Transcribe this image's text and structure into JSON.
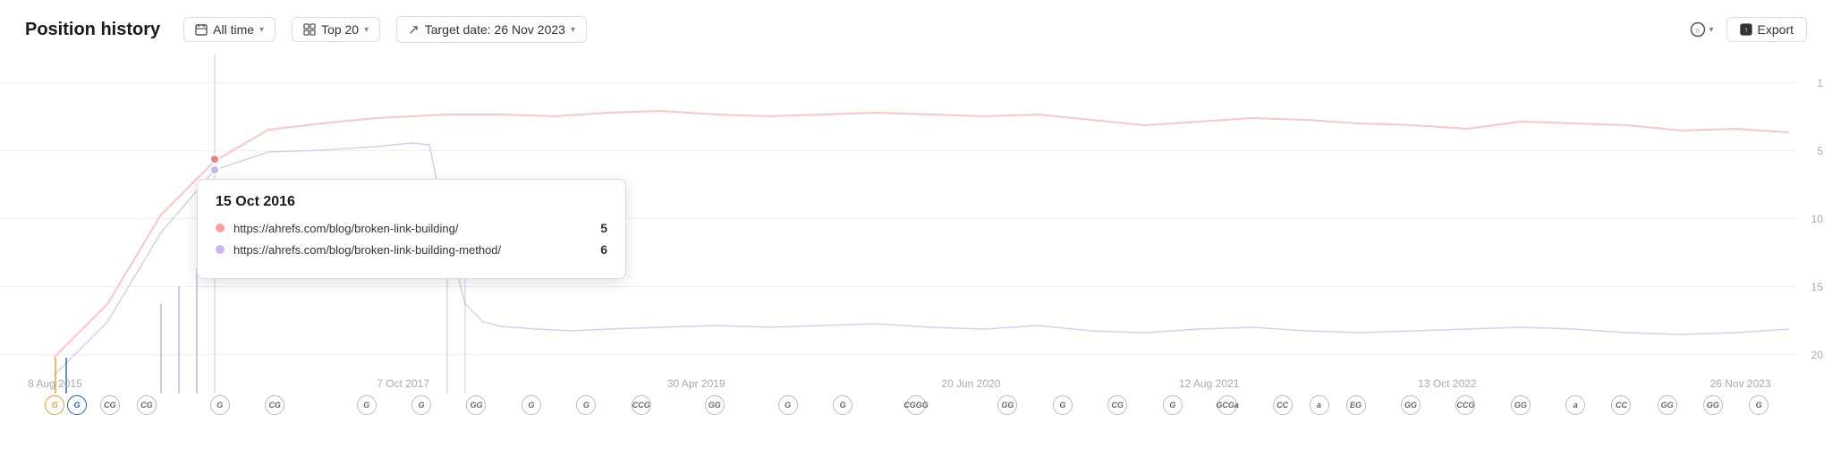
{
  "header": {
    "title": "Position history",
    "alltime_label": "All time",
    "top_label": "Top 20",
    "target_label": "Target date: 26 Nov 2023",
    "export_label": "Export"
  },
  "tooltip": {
    "date": "15 Oct 2016",
    "rows": [
      {
        "url": "https://ahrefs.com/blog/broken-link-building/",
        "value": "5",
        "color": "#f9a0a0"
      },
      {
        "url": "https://ahrefs.com/blog/broken-link-building-method/",
        "value": "6",
        "color": "#c9b8e8"
      }
    ]
  },
  "y_axis": {
    "labels": [
      "1",
      "5",
      "10",
      "15",
      "20"
    ]
  },
  "x_axis": {
    "labels": [
      {
        "text": "8 Aug 2015",
        "pct": 3
      },
      {
        "text": "Oct 2017",
        "pct": 16
      },
      {
        "text": "7 Oct 2017",
        "pct": 22
      },
      {
        "text": "30 Apr 2019",
        "pct": 38
      },
      {
        "text": "20 Jun 2020",
        "pct": 53
      },
      {
        "text": "12 Aug 2021",
        "pct": 66
      },
      {
        "text": "13 Oct 2022",
        "pct": 79
      },
      {
        "text": "26 Nov 2023",
        "pct": 95
      }
    ]
  },
  "event_icons": [
    {
      "label": "G",
      "pct": 3.5
    },
    {
      "label": "G",
      "pct": 5.2
    },
    {
      "label": "CG",
      "pct": 6.8
    },
    {
      "label": "CG",
      "pct": 8.1
    },
    {
      "label": "G",
      "pct": 13
    },
    {
      "label": "G",
      "pct": 15.5
    },
    {
      "label": "CG",
      "pct": 20
    },
    {
      "label": "G",
      "pct": 23
    },
    {
      "label": "GG",
      "pct": 26
    },
    {
      "label": "G",
      "pct": 28.5
    },
    {
      "label": "G",
      "pct": 31
    },
    {
      "label": "CCG",
      "pct": 35
    },
    {
      "label": "GG",
      "pct": 39
    },
    {
      "label": "G",
      "pct": 43
    },
    {
      "label": "G",
      "pct": 46
    },
    {
      "label": "CGGGG",
      "pct": 50
    },
    {
      "label": "GG",
      "pct": 55
    },
    {
      "label": "G",
      "pct": 58
    },
    {
      "label": "CG",
      "pct": 61
    },
    {
      "label": "G",
      "pct": 64
    },
    {
      "label": "GCGa",
      "pct": 67
    },
    {
      "label": "CC",
      "pct": 70
    },
    {
      "label": "a",
      "pct": 72
    },
    {
      "label": "EG",
      "pct": 74
    },
    {
      "label": "GG",
      "pct": 77
    },
    {
      "label": "CCG",
      "pct": 80
    },
    {
      "label": "GG",
      "pct": 83
    },
    {
      "label": "a",
      "pct": 86
    },
    {
      "label": "CC",
      "pct": 88
    },
    {
      "label": "GG",
      "pct": 91
    },
    {
      "label": "GG",
      "pct": 93
    },
    {
      "label": "G",
      "pct": 95.5
    }
  ]
}
